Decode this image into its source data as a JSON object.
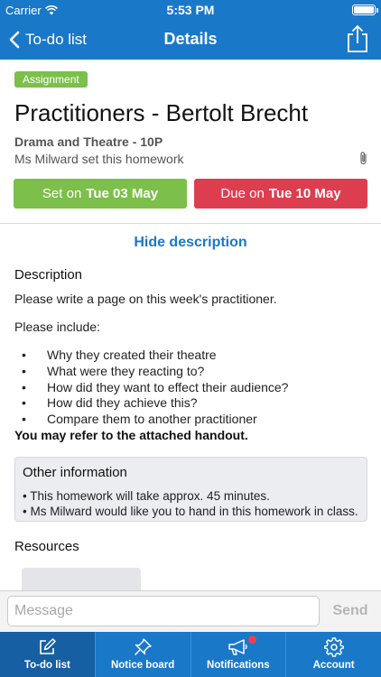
{
  "status_bar": {
    "carrier": "Carrier",
    "time": "5:53 PM"
  },
  "nav": {
    "back_label": "To-do list",
    "title": "Details"
  },
  "homework": {
    "badge": "Assignment",
    "title": "Practitioners - Bertolt Brecht",
    "subject": "Drama and Theatre - 10P",
    "setter": "Ms Milward set this homework",
    "set_prefix": "Set on",
    "set_date": "Tue 03 May",
    "due_prefix": "Due on",
    "due_date": "Tue 10 May",
    "hide_description": "Hide description"
  },
  "description": {
    "heading": "Description",
    "line1": "Please write a page on this week's practitioner.",
    "line2": "Please include:",
    "bullets": [
      "Why they created their theatre",
      "What were they reacting to?",
      "How did they want to effect their audience?",
      "How did they achieve this?",
      "Compare them to another practitioner"
    ],
    "bold_note": "You may refer to the attached handout."
  },
  "other_info": {
    "heading": "Other information",
    "line1": "• This homework will take approx. 45 minutes.",
    "line2": "• Ms Milward would like you to hand in this homework in class."
  },
  "resources": {
    "heading": "Resources"
  },
  "message": {
    "placeholder": "Message",
    "send_label": "Send"
  },
  "tabs": [
    {
      "label": "To-do list",
      "icon": "edit-icon"
    },
    {
      "label": "Notice board",
      "icon": "pin-icon"
    },
    {
      "label": "Notifications",
      "icon": "megaphone-icon"
    },
    {
      "label": "Account",
      "icon": "gear-icon"
    }
  ],
  "colors": {
    "primary_blue": "#1a78c9",
    "badge_green": "#7cbf4a",
    "due_red": "#dd3e4f",
    "notification_dot": "#e8424f"
  }
}
